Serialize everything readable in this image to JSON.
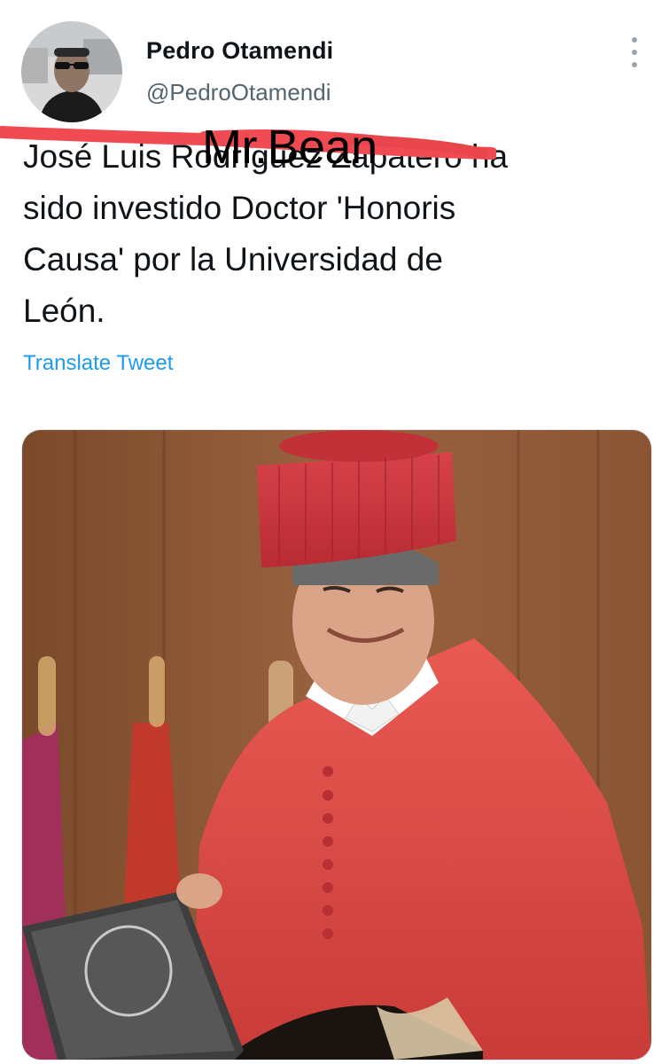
{
  "tweet": {
    "author": {
      "display_name": "Pedro Otamendi",
      "handle": "@PedroOtamendi"
    },
    "text_lines": [
      "José Luis Rodríguez Zapatero ha",
      "sido investido Doctor 'Honoris",
      "Causa' por  la Universidad de",
      "León."
    ],
    "overlay_label": "Mr.Bean",
    "translate_label": "Translate Tweet",
    "more_icon": "more-vertical-icon"
  },
  "colors": {
    "link_blue": "#1d9bf0",
    "scribble_red": "#f04a52",
    "muted_gray": "#536471"
  }
}
